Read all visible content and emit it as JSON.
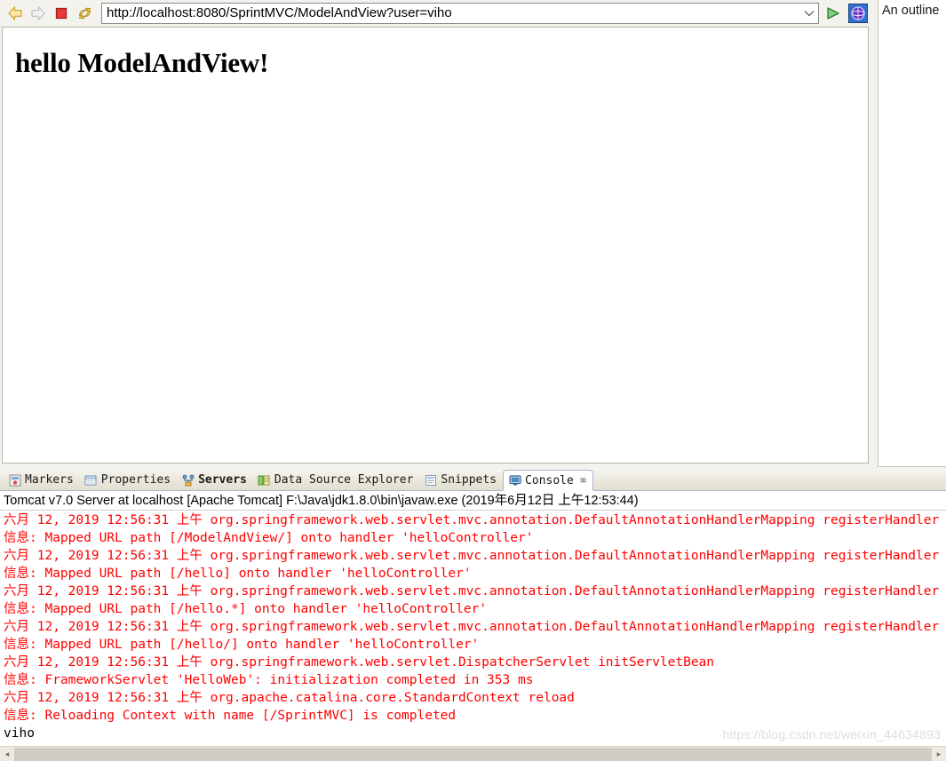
{
  "browser": {
    "toolbar": {
      "back_icon": "back-arrow-icon",
      "forward_icon": "forward-arrow-icon",
      "stop_icon": "stop-icon",
      "refresh_icon": "refresh-icon",
      "dropdown_icon": "chevron-down-icon",
      "go_icon": "go-icon",
      "globe_icon": "globe-icon"
    },
    "url": {
      "value": "http://localhost:8080/SprintMVC/ModelAndView?user=viho",
      "placeholder": "http://"
    },
    "page": {
      "heading": "hello ModelAndView!"
    }
  },
  "outline": {
    "text": "An outline"
  },
  "dock": {
    "tabs": [
      {
        "label": "Markers",
        "icon": "markers-icon",
        "active": false,
        "bold": false,
        "closeable": false
      },
      {
        "label": "Properties",
        "icon": "properties-icon",
        "active": false,
        "bold": false,
        "closeable": false
      },
      {
        "label": "Servers",
        "icon": "servers-icon",
        "active": false,
        "bold": true,
        "closeable": false
      },
      {
        "label": "Data Source Explorer",
        "icon": "datasource-icon",
        "active": false,
        "bold": false,
        "closeable": false
      },
      {
        "label": "Snippets",
        "icon": "snippets-icon",
        "active": false,
        "bold": false,
        "closeable": false
      },
      {
        "label": "Console",
        "icon": "console-icon",
        "active": true,
        "bold": false,
        "closeable": true,
        "close_glyph": "⌧"
      }
    ]
  },
  "console": {
    "header": "Tomcat v7.0 Server at localhost [Apache Tomcat] F:\\Java\\jdk1.8.0\\bin\\javaw.exe (2019年6月12日 上午12:53:44)",
    "lines": [
      {
        "stream": "err",
        "text": "六月 12, 2019 12:56:31 上午 org.springframework.web.servlet.mvc.annotation.DefaultAnnotationHandlerMapping registerHandler"
      },
      {
        "stream": "err",
        "text": "信息: Mapped URL path [/ModelAndView/] onto handler 'helloController'"
      },
      {
        "stream": "err",
        "text": "六月 12, 2019 12:56:31 上午 org.springframework.web.servlet.mvc.annotation.DefaultAnnotationHandlerMapping registerHandler"
      },
      {
        "stream": "err",
        "text": "信息: Mapped URL path [/hello] onto handler 'helloController'"
      },
      {
        "stream": "err",
        "text": "六月 12, 2019 12:56:31 上午 org.springframework.web.servlet.mvc.annotation.DefaultAnnotationHandlerMapping registerHandler"
      },
      {
        "stream": "err",
        "text": "信息: Mapped URL path [/hello.*] onto handler 'helloController'"
      },
      {
        "stream": "err",
        "text": "六月 12, 2019 12:56:31 上午 org.springframework.web.servlet.mvc.annotation.DefaultAnnotationHandlerMapping registerHandler"
      },
      {
        "stream": "err",
        "text": "信息: Mapped URL path [/hello/] onto handler 'helloController'"
      },
      {
        "stream": "err",
        "text": "六月 12, 2019 12:56:31 上午 org.springframework.web.servlet.DispatcherServlet initServletBean"
      },
      {
        "stream": "err",
        "text": "信息: FrameworkServlet 'HelloWeb': initialization completed in 353 ms"
      },
      {
        "stream": "err",
        "text": "六月 12, 2019 12:56:31 上午 org.apache.catalina.core.StandardContext reload"
      },
      {
        "stream": "err",
        "text": "信息: Reloading Context with name [/SprintMVC] is completed"
      },
      {
        "stream": "out",
        "text": "viho"
      }
    ]
  },
  "scrollbar": {
    "left_arrow": "◂",
    "right_arrow": "▸"
  },
  "watermark": "https://blog.csdn.net/weixin_44634893",
  "colors": {
    "console_error": "#ff0000",
    "console_out": "#000000",
    "chrome": "#f3f2ec",
    "tab_active": "#ffffff",
    "accent_border": "#a9b7c9"
  }
}
